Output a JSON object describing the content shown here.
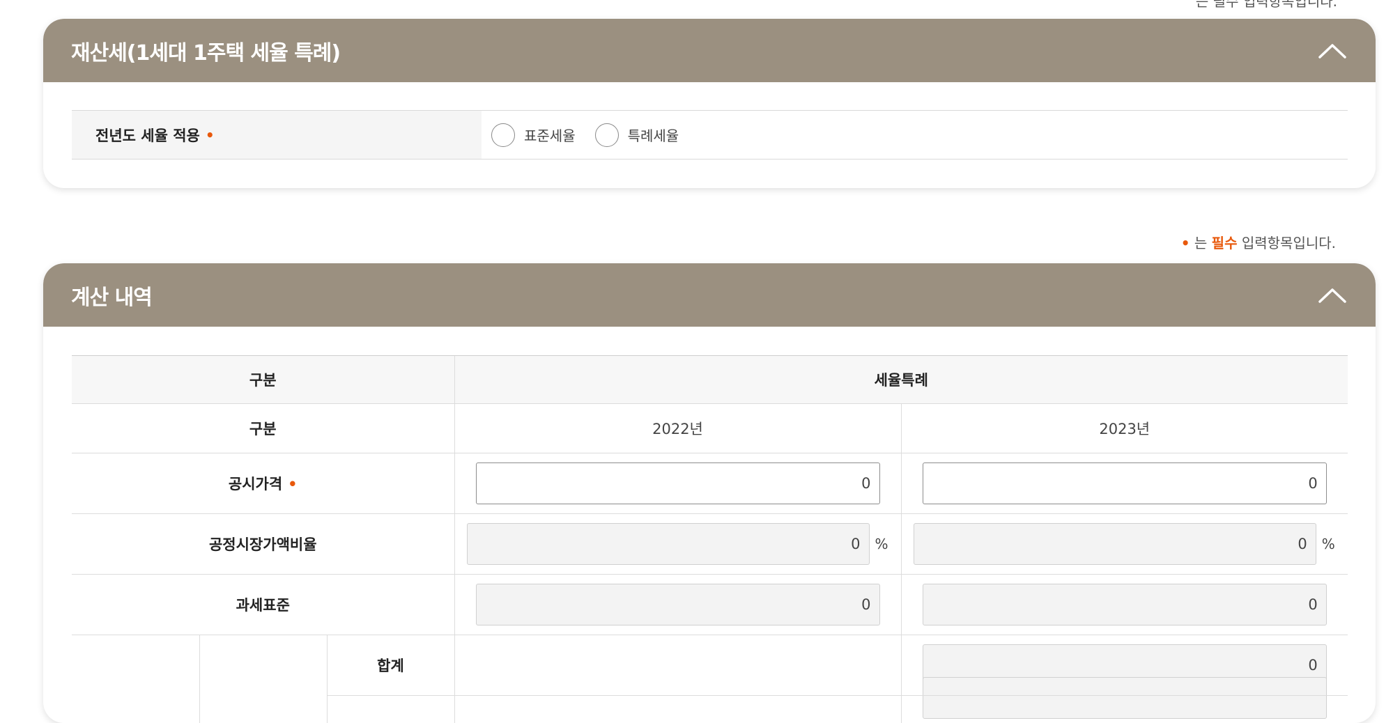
{
  "top_note_cut": "는 필수 입력항목입니다.",
  "required_note": {
    "dot": "•",
    "prefix": "는 ",
    "word": "필수",
    "suffix": " 입력항목입니다."
  },
  "panel1": {
    "title": "재산세(1세대 1주택 세율 특례)",
    "collapse_icon": "chevron-up-icon",
    "row_label": "전년도 세율 적용",
    "required_mark": "•",
    "options": [
      {
        "label": "표준세율",
        "selected": false
      },
      {
        "label": "특례세율",
        "selected": false
      }
    ]
  },
  "panel2": {
    "title": "계산 내역",
    "collapse_icon": "chevron-up-icon",
    "header_category": "구분",
    "header_group": "세율특례",
    "sub_category": "구분",
    "years": [
      "2022년",
      "2023년"
    ],
    "rows": [
      {
        "label": "공시가격",
        "required": "•",
        "values": [
          "0",
          "0"
        ],
        "editable": true
      },
      {
        "label": "공정시장가액비율",
        "values": [
          "0",
          "0"
        ],
        "unit": "%",
        "editable": false
      },
      {
        "label": "과세표준",
        "values": [
          "0",
          "0"
        ],
        "editable": false
      }
    ],
    "sum_row": {
      "label": "합계",
      "value": "0"
    }
  },
  "colors": {
    "header_bg": "#9b9080",
    "required_accent": "#e8590c"
  }
}
